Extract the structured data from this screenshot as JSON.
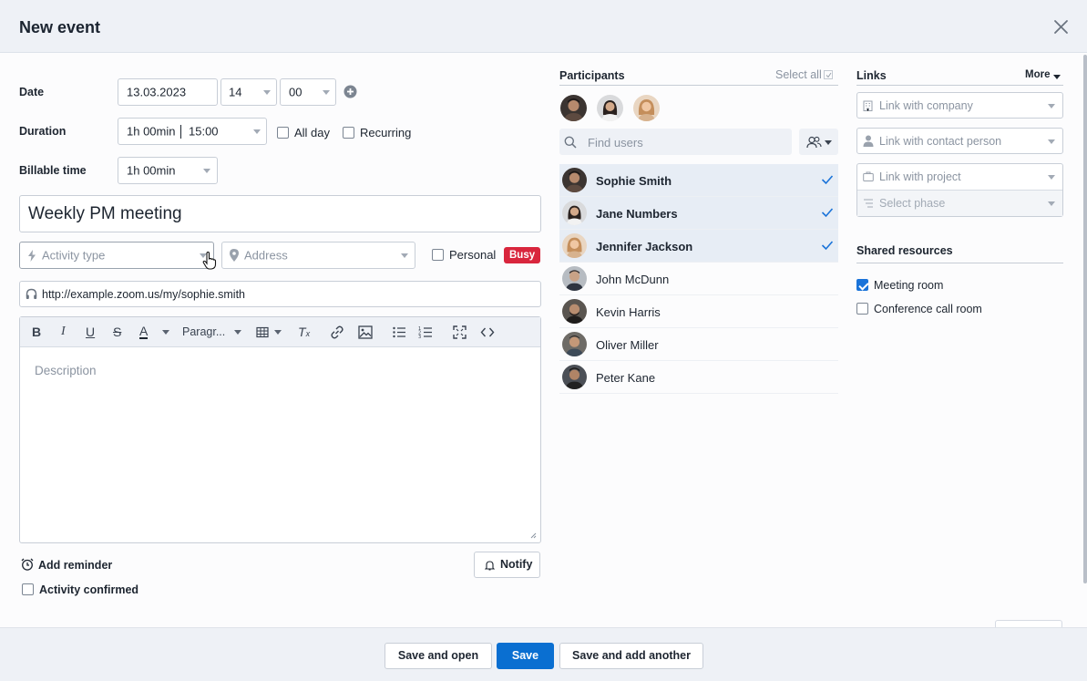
{
  "header": {
    "title": "New event"
  },
  "form": {
    "date_label": "Date",
    "date_value": "13.03.2023",
    "hour_value": "14",
    "minute_value": "00",
    "duration_label": "Duration",
    "duration_value": "1h 00min",
    "end_time_value": "15:00",
    "all_day_label": "All day",
    "recurring_label": "Recurring",
    "billable_label": "Billable time",
    "billable_value": "1h 00min",
    "title_value": "Weekly PM meeting",
    "activity_type_placeholder": "Activity type",
    "address_placeholder": "Address",
    "personal_label": "Personal",
    "busy_badge": "Busy",
    "url_value": "http://example.zoom.us/my/sophie.smith",
    "paragraph_label": "Paragr...",
    "description_placeholder": "Description",
    "add_reminder_label": "Add reminder",
    "notify_label": "Notify",
    "activity_confirmed_label": "Activity confirmed"
  },
  "participants": {
    "title": "Participants",
    "select_all_label": "Select all",
    "search_placeholder": "Find users",
    "list": [
      {
        "name": "Sophie Smith",
        "selected": true
      },
      {
        "name": "Jane Numbers",
        "selected": true
      },
      {
        "name": "Jennifer Jackson",
        "selected": true
      },
      {
        "name": "John McDunn",
        "selected": false
      },
      {
        "name": "Kevin Harris",
        "selected": false
      },
      {
        "name": "Oliver Miller",
        "selected": false
      },
      {
        "name": "Peter Kane",
        "selected": false
      }
    ]
  },
  "links": {
    "title": "Links",
    "more_label": "More",
    "company_placeholder": "Link with company",
    "contact_placeholder": "Link with contact person",
    "project_placeholder": "Link with project",
    "phase_placeholder": "Select phase"
  },
  "shared_resources": {
    "title": "Shared resources",
    "meeting_room_label": "Meeting room",
    "meeting_room_checked": true,
    "conference_room_label": "Conference call room",
    "conference_room_checked": false
  },
  "footer": {
    "save_and_open_label": "Save and open",
    "save_label": "Save",
    "save_and_add_label": "Save and add another"
  },
  "colors": {
    "primary": "#0a6fd1",
    "busy": "#d9263d",
    "selected_row": "#e7edf5"
  }
}
